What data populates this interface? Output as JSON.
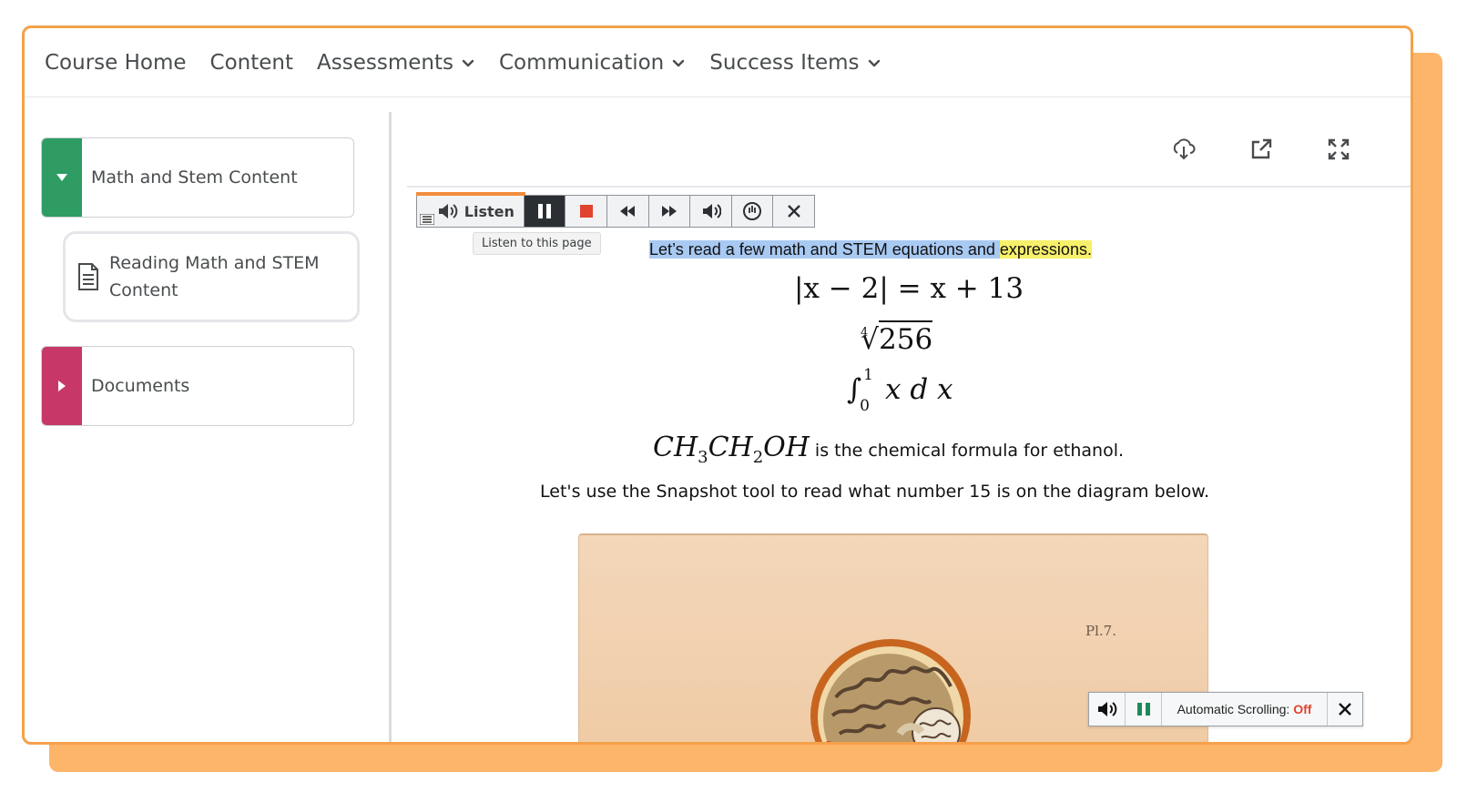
{
  "nav": {
    "items": [
      {
        "label": "Course Home",
        "dropdown": false
      },
      {
        "label": "Content",
        "dropdown": false
      },
      {
        "label": "Assessments",
        "dropdown": true
      },
      {
        "label": "Communication",
        "dropdown": true
      },
      {
        "label": "Success Items",
        "dropdown": true
      }
    ]
  },
  "sidebar": {
    "modules": [
      {
        "label": "Math and Stem Content",
        "expanded": true,
        "color": "#2e9c63"
      },
      {
        "label": "Documents",
        "expanded": false,
        "color": "#c73868"
      }
    ],
    "topic": {
      "label": "Reading Math and STEM Content",
      "icon": "document-icon"
    }
  },
  "content_toolbar": {
    "icons": [
      "cloud-download-icon",
      "open-external-icon",
      "fullscreen-icon"
    ]
  },
  "read_aloud": {
    "listen_label": "Listen",
    "tooltip": "Listen to this page",
    "accent": "#f28c3b"
  },
  "reading": {
    "highlight_blue": "Let’s read a few math and STEM equations and ",
    "highlight_yellow": "expressions.",
    "eq1": "|x − 2| = x + 13",
    "eq2_index": "4",
    "eq2_value": "256",
    "eq3_lower": "0",
    "eq3_upper": "1",
    "eq3_body": "x d x",
    "chem_text": "is the chemical formula for ethanol.",
    "snapshot_text": "Let's use the Snapshot tool to read what number 15 is on the diagram below.",
    "plate_label": "Pl.7."
  },
  "scroll_bar": {
    "label": "Automatic Scrolling: ",
    "state": "Off",
    "state_color": "#e0442f"
  }
}
